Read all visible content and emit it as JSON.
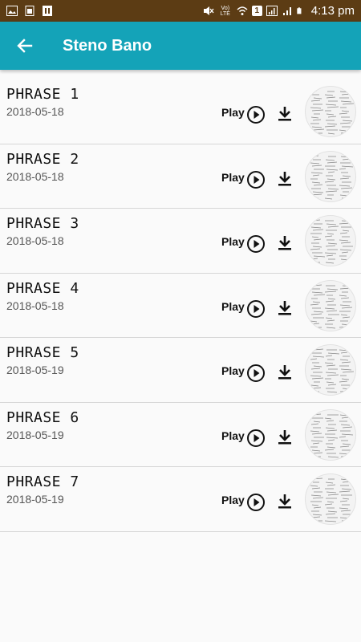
{
  "status_bar": {
    "time": "4:13 pm",
    "badge": "1",
    "network_label": "Vo) LTE",
    "icons": [
      "image-icon",
      "sim-icon",
      "notification-icon",
      "mute-icon",
      "wifi-icon",
      "signal-icon",
      "signal-icon",
      "battery-icon"
    ]
  },
  "app_bar": {
    "title": "Steno Bano",
    "back_icon": "arrow-left-icon",
    "color": "#14a3b8"
  },
  "list": {
    "play_label": "Play",
    "items": [
      {
        "title": "PHRASE  1",
        "date": "2018-05-18"
      },
      {
        "title": "PHRASE  2",
        "date": "2018-05-18"
      },
      {
        "title": "PHRASE  3",
        "date": "2018-05-18"
      },
      {
        "title": "PHRASE  4",
        "date": "2018-05-18"
      },
      {
        "title": "PHRASE  5",
        "date": "2018-05-19"
      },
      {
        "title": "PHRASE  6",
        "date": "2018-05-19"
      },
      {
        "title": "PHRASE  7",
        "date": "2018-05-19"
      }
    ]
  }
}
